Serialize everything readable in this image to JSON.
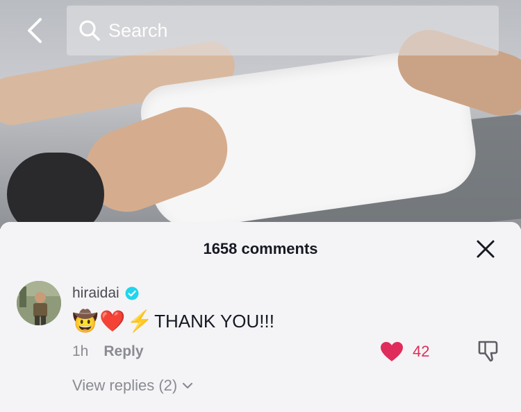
{
  "search": {
    "placeholder": "Search"
  },
  "comments": {
    "count_label": "1658 comments",
    "items": [
      {
        "username": "hiraidai",
        "verified": true,
        "emojis": [
          "🤠",
          "❤️",
          "⚡"
        ],
        "text": "THANK YOU!!!",
        "time": "1h",
        "reply_label": "Reply",
        "likes": "42",
        "liked": true,
        "view_replies_label": "View replies (2)"
      }
    ]
  },
  "colors": {
    "like": "#e02c5a",
    "verified": "#20d5ec"
  }
}
